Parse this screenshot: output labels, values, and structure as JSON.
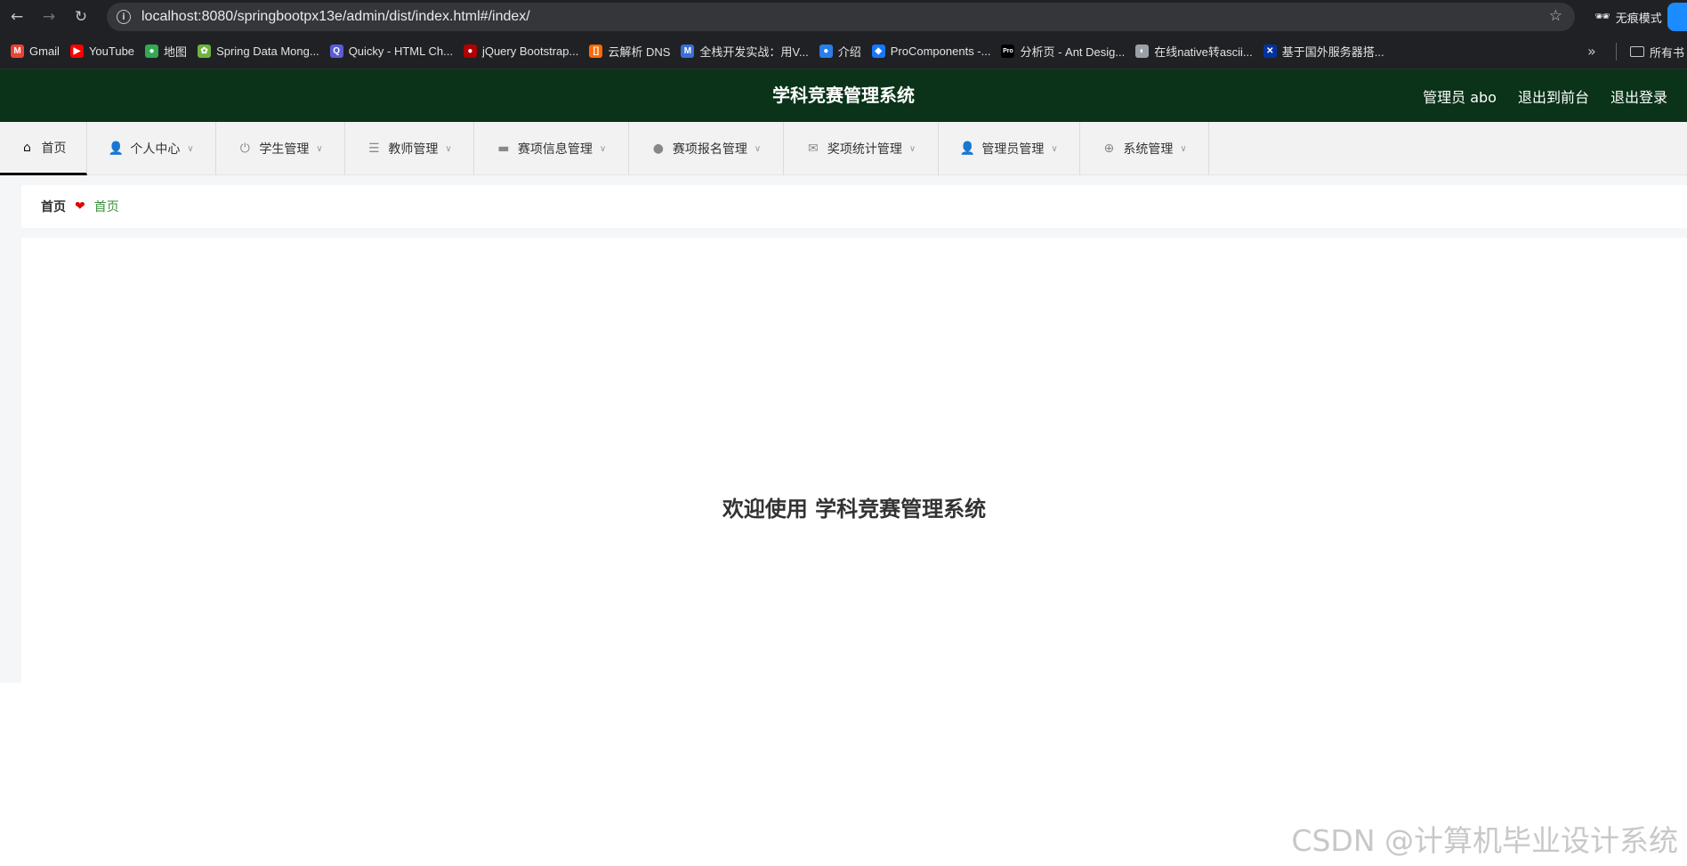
{
  "browser": {
    "url": "localhost:8080/springbootpx13e/admin/dist/index.html#/index/",
    "incognito_label": "无痕模式",
    "bookmarks": [
      {
        "label": "Gmail",
        "icon": "gmail-icon",
        "color": "#ea4335"
      },
      {
        "label": "YouTube",
        "icon": "youtube-icon",
        "color": "#ff0000"
      },
      {
        "label": "地图",
        "icon": "maps-icon",
        "color": "#34a853"
      },
      {
        "label": "Spring Data Mong...",
        "icon": "spring-icon",
        "color": "#6db33f"
      },
      {
        "label": "Quicky - HTML Ch...",
        "icon": "quicky-icon",
        "color": "#5b5bd6"
      },
      {
        "label": "jQuery Bootstrap...",
        "icon": "jquery-icon",
        "color": "#b00000"
      },
      {
        "label": "云解析 DNS",
        "icon": "aliyun-icon",
        "color": "#ff6a00"
      },
      {
        "label": "全栈开发实战：用V...",
        "icon": "m-icon",
        "color": "#3b6fd6"
      },
      {
        "label": "介绍",
        "icon": "intro-icon",
        "color": "#2b7de9"
      },
      {
        "label": "ProComponents -...",
        "icon": "procomponents-icon",
        "color": "#1677ff"
      },
      {
        "label": "分析页 - Ant Desig...",
        "icon": "pro-icon",
        "color": "#000000"
      },
      {
        "label": "在线native转ascii...",
        "icon": "globe-icon",
        "color": "#9aa0a6"
      },
      {
        "label": "基于国外服务器搭...",
        "icon": "flag-icon",
        "color": "#0033a0"
      }
    ],
    "all_bookmarks_label": "所有书"
  },
  "app": {
    "title": "学科竞赛管理系统",
    "header_links": [
      "管理员 abo",
      "退出到前台",
      "退出登录"
    ],
    "header_bg": "#0a3319"
  },
  "menu": [
    {
      "label": "首页",
      "icon": "home-icon",
      "active": true,
      "has_dropdown": false
    },
    {
      "label": "个人中心",
      "icon": "user-icon",
      "active": false,
      "has_dropdown": true
    },
    {
      "label": "学生管理",
      "icon": "power-icon",
      "active": false,
      "has_dropdown": true
    },
    {
      "label": "教师管理",
      "icon": "sliders-icon",
      "active": false,
      "has_dropdown": true
    },
    {
      "label": "赛项信息管理",
      "icon": "wallet-icon",
      "active": false,
      "has_dropdown": true
    },
    {
      "label": "赛项报名管理",
      "icon": "balloon-icon",
      "active": false,
      "has_dropdown": true
    },
    {
      "label": "奖项统计管理",
      "icon": "mail-icon",
      "active": false,
      "has_dropdown": true
    },
    {
      "label": "管理员管理",
      "icon": "admin-user-icon",
      "active": false,
      "has_dropdown": true
    },
    {
      "label": "系统管理",
      "icon": "crosshair-icon",
      "active": false,
      "has_dropdown": true
    }
  ],
  "breadcrumb": {
    "home": "首页",
    "separator_icon": "heart-icon",
    "current": "首页"
  },
  "main": {
    "welcome": "欢迎使用 学科竞赛管理系统"
  },
  "watermark": "CSDN @计算机毕业设计系统"
}
